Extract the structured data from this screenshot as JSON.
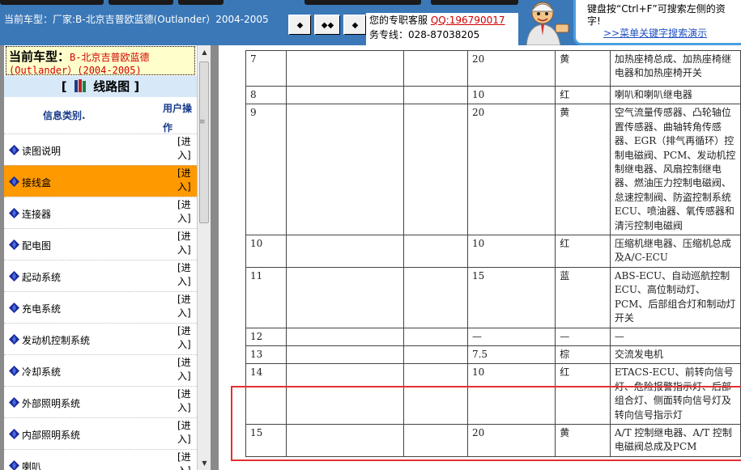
{
  "header": {
    "current_model": "当前车型：厂家:B-北京吉普欧蓝德(Outlander）2004-2005",
    "nav_buttons": [
      "◆",
      "◆◆",
      "◆"
    ],
    "service_label": "您的专职客服",
    "qq": "QQ:196790017",
    "hotline": "务专线：028-87038205",
    "tip_text": "键盘按“Ctrl+F”可搜索左侧的资字!",
    "tip_link": ">>菜单关键字搜索演示"
  },
  "sidebar": {
    "model_label": "当前车型：",
    "model_value_1": "B-北京吉普欧蓝德",
    "model_value_2": "(Outlander）(2004-2005)",
    "section_title": "线路图",
    "bracket_left": "[",
    "bracket_right": "]",
    "col_category": "信息类别.",
    "col_action": "用户操作",
    "enter_label": "[进入]",
    "items": [
      {
        "label": "读图说明",
        "active": false
      },
      {
        "label": "接线盒",
        "active": true
      },
      {
        "label": "连接器",
        "active": false
      },
      {
        "label": "配电图",
        "active": false
      },
      {
        "label": "起动系统",
        "active": false
      },
      {
        "label": "充电系统",
        "active": false
      },
      {
        "label": "发动机控制系统",
        "active": false
      },
      {
        "label": "冷却系统",
        "active": false
      },
      {
        "label": "外部照明系统",
        "active": false
      },
      {
        "label": "内部照明系统",
        "active": false
      },
      {
        "label": "喇叭",
        "active": false
      }
    ]
  },
  "fuse_table": {
    "rows": [
      {
        "no": "7",
        "amp": "20",
        "color": "黄",
        "desc": "加热座椅总成、加热座椅继电器和加热座椅开关"
      },
      {
        "no": "8",
        "amp": "10",
        "color": "红",
        "desc": "喇叭和喇叭继电器"
      },
      {
        "no": "9",
        "amp": "20",
        "color": "黄",
        "desc": "空气流量传感器、凸轮轴位置传感器、曲轴转角传感器、EGR（排气再循环）控制电磁阀、PCM、发动机控制继电器、风扇控制继电器、燃油压力控制电磁阀、怠速控制阀、防盗控制系统ECU、喷油器、氧传感器和清污控制电磁阀"
      },
      {
        "no": "10",
        "amp": "10",
        "color": "红",
        "desc": "压缩机继电器、压缩机总成及A/C-ECU"
      },
      {
        "no": "11",
        "amp": "15",
        "color": "蓝",
        "desc": "ABS-ECU、自动巡航控制ECU、高位制动灯、PCM、后部组合灯和制动灯开关"
      },
      {
        "no": "12",
        "amp": "—",
        "color": "—",
        "desc": "—"
      },
      {
        "no": "13",
        "amp": "7.5",
        "color": "棕",
        "desc": "交流发电机"
      },
      {
        "no": "14",
        "amp": "10",
        "color": "红",
        "desc": "ETACS-ECU、前转向信号灯、危险报警指示灯、后部组合灯、侧面转向信号灯及转向信号指示灯"
      },
      {
        "no": "15",
        "amp": "20",
        "color": "黄",
        "desc": "A/T 控制继电器、A/T 控制电磁阀总成及PCM"
      }
    ]
  }
}
